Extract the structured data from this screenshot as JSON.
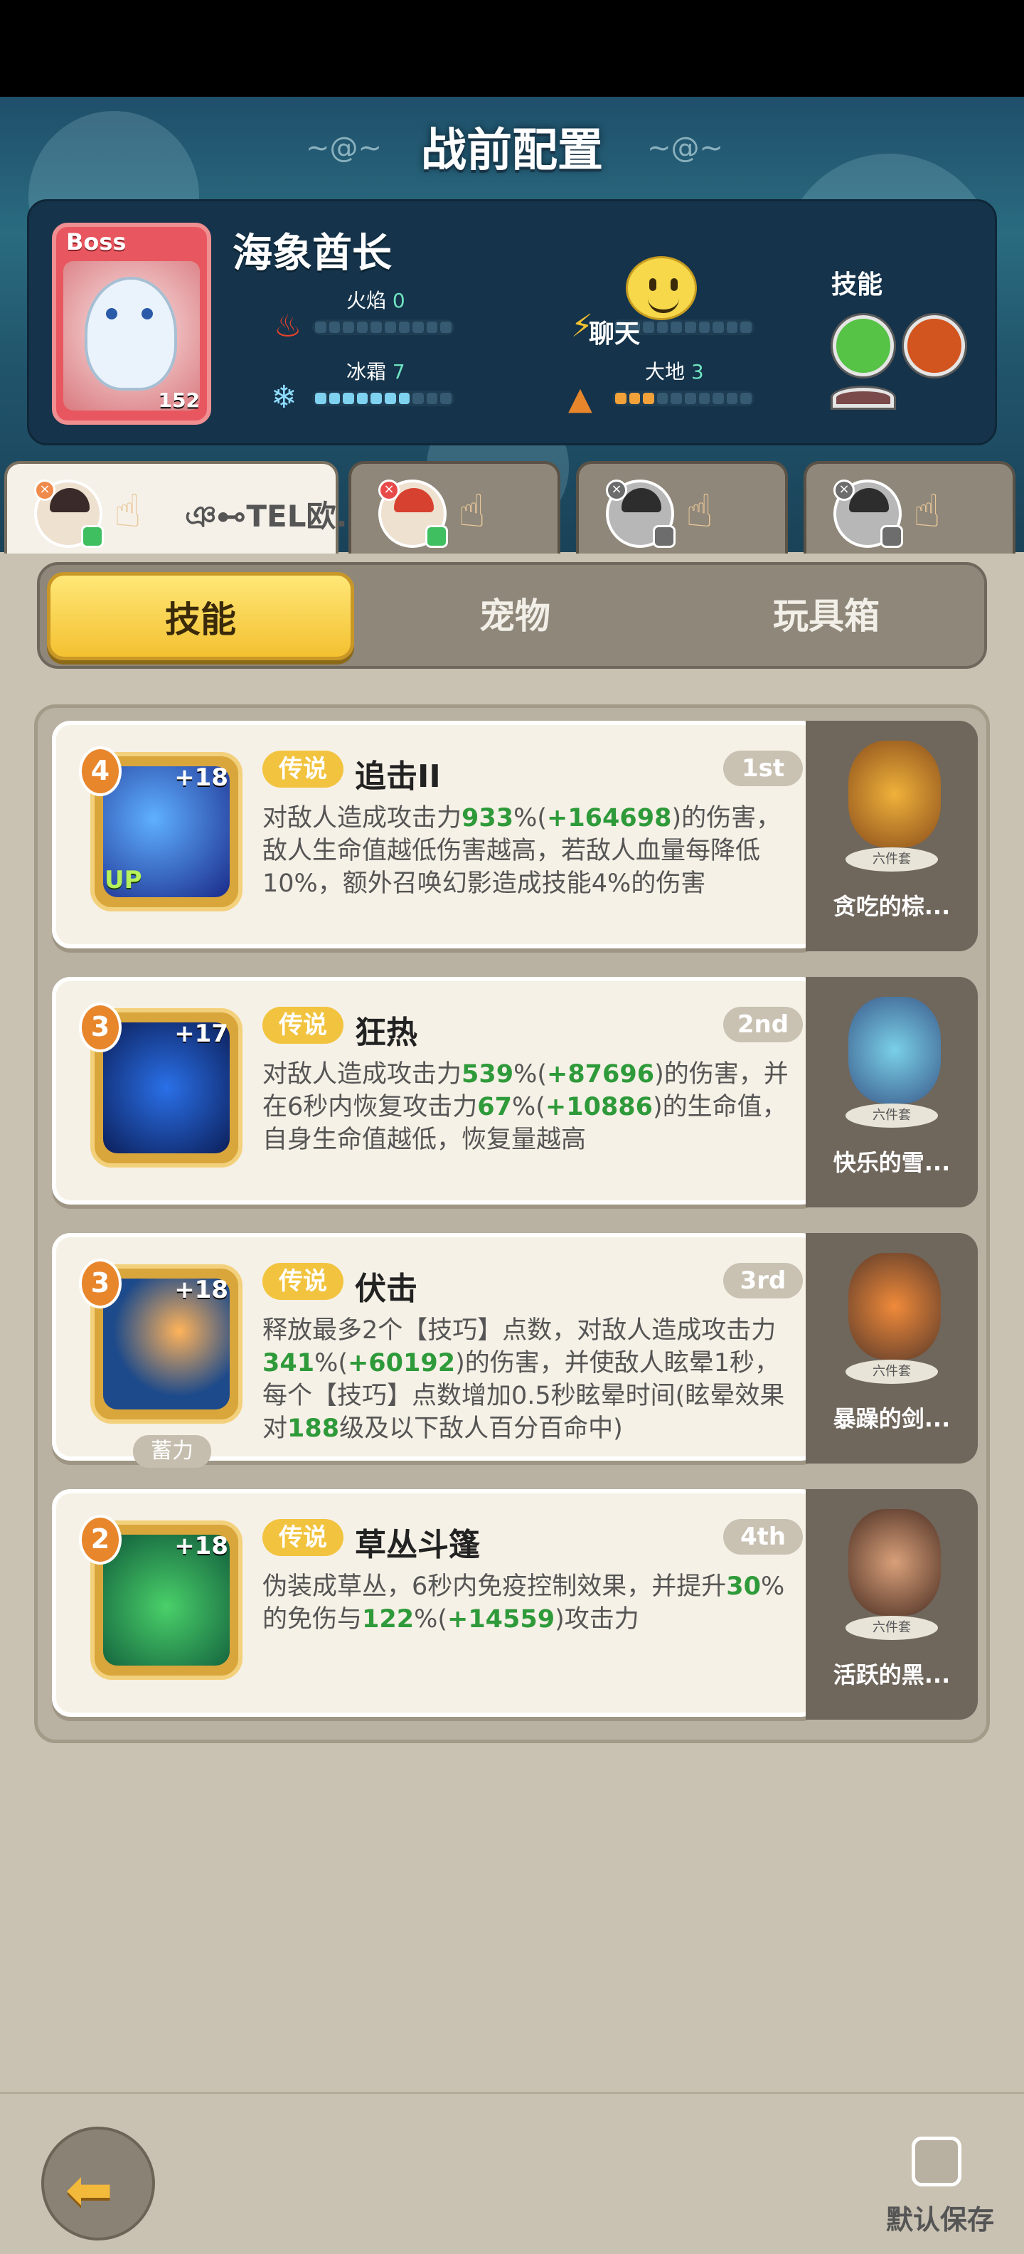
{
  "header": {
    "title": "战前配置"
  },
  "boss": {
    "tag": "Boss",
    "name": "海象酋长",
    "level": "152",
    "elements": [
      {
        "label": "火焰",
        "value": "0"
      },
      {
        "label": "冰霜",
        "value": "7"
      },
      {
        "label": "大地",
        "value": "3"
      }
    ],
    "levels": {
      "fire": 0,
      "ice": 7,
      "earth": 3
    },
    "skills_label": "技能",
    "chat_label": "聊天"
  },
  "heroes": [
    {
      "name": "ঞ⊷TEL欧..",
      "status": "online"
    },
    {
      "name": "",
      "status": "online"
    },
    {
      "name": "",
      "status": "offline"
    },
    {
      "name": "",
      "status": "offline"
    }
  ],
  "tabs": [
    {
      "label": "技能",
      "active": true
    },
    {
      "label": "宠物",
      "active": false
    },
    {
      "label": "玩具箱",
      "active": false
    }
  ],
  "skills": [
    {
      "level": "4",
      "plus": "+18",
      "up": "UP",
      "tag": "传说",
      "name": "追击II",
      "rank": "1st",
      "desc": [
        "对敌人造成攻击力",
        "933",
        "%(",
        "+164698",
        ")的伤害，敌人生命值越低伤害越高，若敌人血量每降低10%，额外召唤幻影造成技能4%的伤害"
      ],
      "pet_name": "贪吃的棕...",
      "pet_set": "六件套"
    },
    {
      "level": "3",
      "plus": "+17",
      "tag": "传说",
      "name": "狂热",
      "rank": "2nd",
      "desc": [
        "对敌人造成攻击力",
        "539",
        "%(",
        "+87696",
        ")的伤害，并在6秒内恢复攻击力",
        "67",
        "%(",
        "+10886",
        ")的生命值，自身生命值越低，恢复量越高"
      ],
      "pet_name": "快乐的雪...",
      "pet_set": "六件套"
    },
    {
      "level": "3",
      "plus": "+18",
      "charge": "蓄力",
      "tag": "传说",
      "name": "伏击",
      "rank": "3rd",
      "desc": [
        "释放最多2个【技巧】点数，对敌人造成攻击力",
        "341",
        "%(",
        "+60192",
        ")的伤害，并使敌人眩晕1秒，每个【技巧】点数增加0.5秒眩晕时间(眩晕效果对",
        "188",
        "级及以下敌人百分百命中)"
      ],
      "pet_name": "暴躁的剑...",
      "pet_set": "六件套"
    },
    {
      "level": "2",
      "plus": "+18",
      "tag": "传说",
      "name": "草丛斗篷",
      "rank": "4th",
      "desc": [
        "伪装成草丛，6秒内免疫控制效果，并提升",
        "30",
        "%的免伤与",
        "122",
        "%(",
        "+14559",
        ")攻击力"
      ],
      "pet_name": "活跃的黑...",
      "pet_set": "六件套"
    }
  ],
  "footer": {
    "default_save": "默认保存"
  },
  "colors": {
    "accent_yellow": "#f3c131",
    "value_green": "#2e9a3a",
    "legend_tag": "#f2c33e"
  }
}
